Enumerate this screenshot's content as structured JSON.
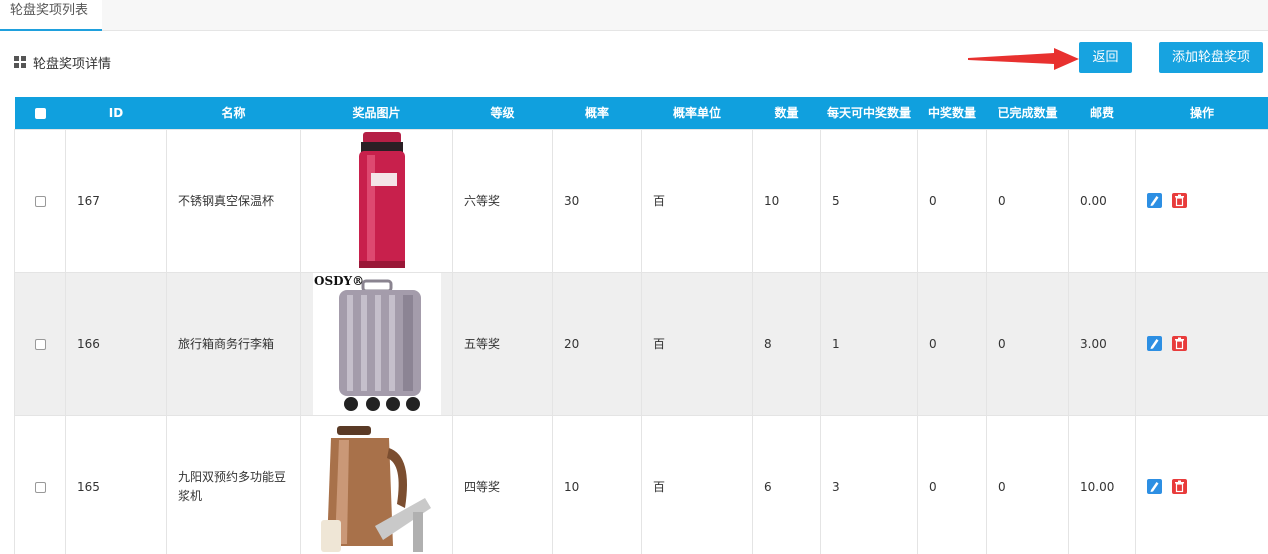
{
  "tab": {
    "label": "轮盘奖项列表"
  },
  "panel": {
    "title": "轮盘奖项详情"
  },
  "buttons": {
    "back": "返回",
    "add": "添加轮盘奖项"
  },
  "table": {
    "columns": [
      "ID",
      "名称",
      "奖品图片",
      "等级",
      "概率",
      "概率单位",
      "数量",
      "每天可中奖数量",
      "中奖数量",
      "已完成数量",
      "邮费",
      "操作"
    ],
    "rows": [
      {
        "id": "167",
        "name": "不锈钢真空保温杯",
        "image_icon": "vacuum-cup-image",
        "level": "六等奖",
        "prob": "30",
        "unit": "百",
        "qty": "10",
        "daily": "5",
        "won": "0",
        "done": "0",
        "fee": "0.00"
      },
      {
        "id": "166",
        "name": "旅行箱商务行李箱",
        "image_icon": "suitcase-image",
        "image_text": "OSDY®",
        "level": "五等奖",
        "prob": "20",
        "unit": "百",
        "qty": "8",
        "daily": "1",
        "won": "0",
        "done": "0",
        "fee": "3.00"
      },
      {
        "id": "165",
        "name": "九阳双预约多功能豆浆机",
        "image_icon": "soymilk-maker-image",
        "level": "四等奖",
        "prob": "10",
        "unit": "百",
        "qty": "6",
        "daily": "3",
        "won": "0",
        "done": "0",
        "fee": "10.00"
      }
    ]
  },
  "colors": {
    "accent": "#10a0de",
    "button": "#17a3e0",
    "edit": "#2d8fe3",
    "delete": "#e83b3b",
    "arrow": "#e8312f"
  }
}
